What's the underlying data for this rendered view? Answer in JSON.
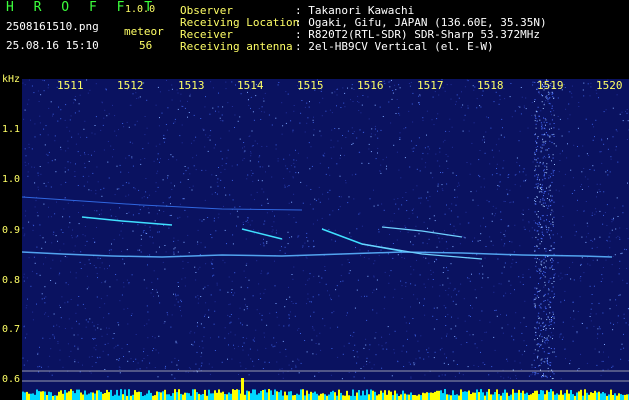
{
  "header": {
    "brand": "H R O F F T",
    "version": "1.0.0",
    "filename": "2508161510.png",
    "timestamp": "25.08.16 15:10",
    "meteor_label": "meteor",
    "meteor_count": "56"
  },
  "info": [
    {
      "key": "Observer",
      "value": ": Takanori Kawachi"
    },
    {
      "key": "Receiving Location",
      "value": ": Ogaki, Gifu, JAPAN (136.60E, 35.35N)"
    },
    {
      "key": "Receiver",
      "value": ": R820T2(RTL-SDR) SDR-Sharp 53.372MHz"
    },
    {
      "key": "Receiving antenna",
      "value": ": 2el-HB9CV Vertical (el. E-W)"
    }
  ],
  "axis": {
    "unit": "kHz",
    "y_ticks": [
      "1.1",
      "1.0",
      "0.9",
      "0.8",
      "0.7",
      "0.6"
    ],
    "x_ticks": [
      "1511",
      "1512",
      "1513",
      "1514",
      "1515",
      "1516",
      "1517",
      "1518",
      "1519",
      "1520"
    ]
  },
  "colors": {
    "label_yellow": "#ffff66",
    "brand_green": "#3cff3c",
    "background_blue": "#0a1260",
    "trace_cyan": "#40e0ff",
    "histogram_cyan": "#00d8ff",
    "histogram_yellow": "#ffff00"
  }
}
